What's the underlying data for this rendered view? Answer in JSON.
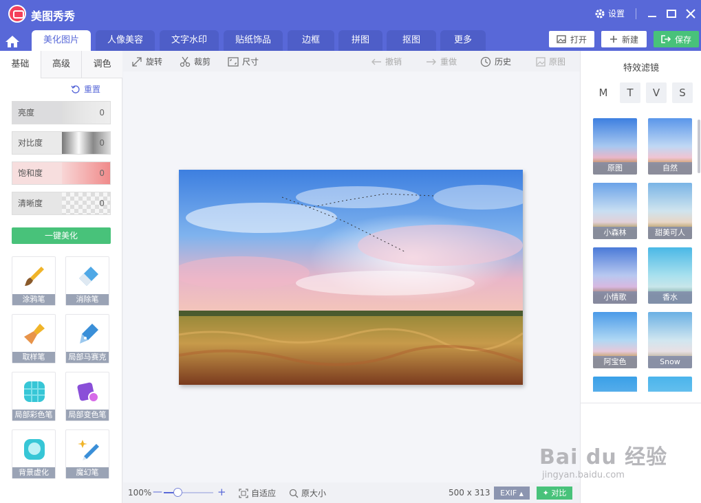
{
  "app": {
    "title": "美图秀秀",
    "settings_label": "设置"
  },
  "tabs": [
    {
      "label": "美化图片",
      "active": true
    },
    {
      "label": "人像美容"
    },
    {
      "label": "文字水印"
    },
    {
      "label": "贴纸饰品"
    },
    {
      "label": "边框"
    },
    {
      "label": "拼图"
    },
    {
      "label": "抠图"
    },
    {
      "label": "更多"
    }
  ],
  "actions": {
    "open": "打开",
    "new": "新建",
    "save": "保存"
  },
  "left": {
    "subtabs": [
      "基础",
      "高级",
      "调色"
    ],
    "reset": "重置",
    "sliders": [
      {
        "label": "亮度",
        "value": "0"
      },
      {
        "label": "对比度",
        "value": "0"
      },
      {
        "label": "饱和度",
        "value": "0"
      },
      {
        "label": "清晰度",
        "value": "0"
      }
    ],
    "auto_beautify": "一键美化",
    "tools": [
      "涂鸦笔",
      "消除笔",
      "取样笔",
      "局部马赛克",
      "局部彩色笔",
      "局部变色笔",
      "背景虚化",
      "魔幻笔"
    ]
  },
  "toolbar": {
    "rotate": "旋转",
    "crop": "裁剪",
    "size": "尺寸",
    "undo": "撤销",
    "redo": "重做",
    "history": "历史",
    "original": "原图"
  },
  "bottom": {
    "zoom": "100%",
    "fit": "自适应",
    "actual": "原大小",
    "dimensions": "500 x 313",
    "exif": "EXIF",
    "compare": "对比"
  },
  "right": {
    "title": "特效滤镜",
    "categories": [
      "M",
      "T",
      "V",
      "S"
    ],
    "filters": [
      "原图",
      "自然",
      "小森林",
      "甜美可人",
      "小情歌",
      "香水",
      "阿宝色",
      "Snow"
    ]
  },
  "watermark": {
    "main": "Bai du 经验",
    "sub": "jingyan.baidu.com"
  },
  "colors": {
    "brand": "#5868d8",
    "accent": "#48c27a",
    "logo": "#f4405a"
  }
}
